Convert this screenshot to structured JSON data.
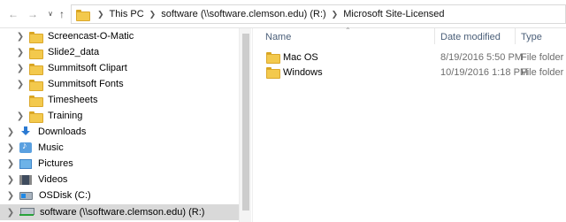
{
  "toolbar": {
    "back_icon": "back-arrow-icon",
    "forward_icon": "forward-arrow-icon",
    "recent_icon": "chevron-down-icon",
    "up_icon": "up-arrow-icon"
  },
  "breadcrumb": {
    "items": [
      "This PC",
      "software (\\\\software.clemson.edu) (R:)",
      "Microsoft Site-Licensed"
    ]
  },
  "nav": {
    "items": [
      {
        "label": "Screencast-O-Matic",
        "icon": "folder-icon",
        "expandable": true
      },
      {
        "label": "Slide2_data",
        "icon": "folder-icon",
        "expandable": true
      },
      {
        "label": "Summitsoft Clipart",
        "icon": "folder-icon",
        "expandable": true
      },
      {
        "label": "Summitsoft Fonts",
        "icon": "folder-icon",
        "expandable": true
      },
      {
        "label": "Timesheets",
        "icon": "folder-icon",
        "expandable": false
      },
      {
        "label": "Training",
        "icon": "folder-icon",
        "expandable": true
      },
      {
        "label": "Downloads",
        "icon": "download-icon",
        "expandable": true
      },
      {
        "label": "Music",
        "icon": "music-icon",
        "expandable": true
      },
      {
        "label": "Pictures",
        "icon": "pictures-icon",
        "expandable": true
      },
      {
        "label": "Videos",
        "icon": "videos-icon",
        "expandable": true
      },
      {
        "label": "OSDisk (C:)",
        "icon": "disk-icon",
        "expandable": true
      },
      {
        "label": "software (\\\\software.clemson.edu) (R:)",
        "icon": "network-drive-icon",
        "expandable": true,
        "selected": true
      }
    ]
  },
  "content": {
    "columns": {
      "name": "Name",
      "date": "Date modified",
      "type": "Type"
    },
    "files": [
      {
        "name": "Mac OS",
        "date": "8/19/2016 5:50 PM",
        "type": "File folder"
      },
      {
        "name": "Windows",
        "date": "10/19/2016 1:18 PM",
        "type": "File folder"
      }
    ]
  },
  "colors": {
    "folder": "#f3c94d",
    "selected_bg": "#d9d9d9",
    "header_text": "#4c607a"
  }
}
